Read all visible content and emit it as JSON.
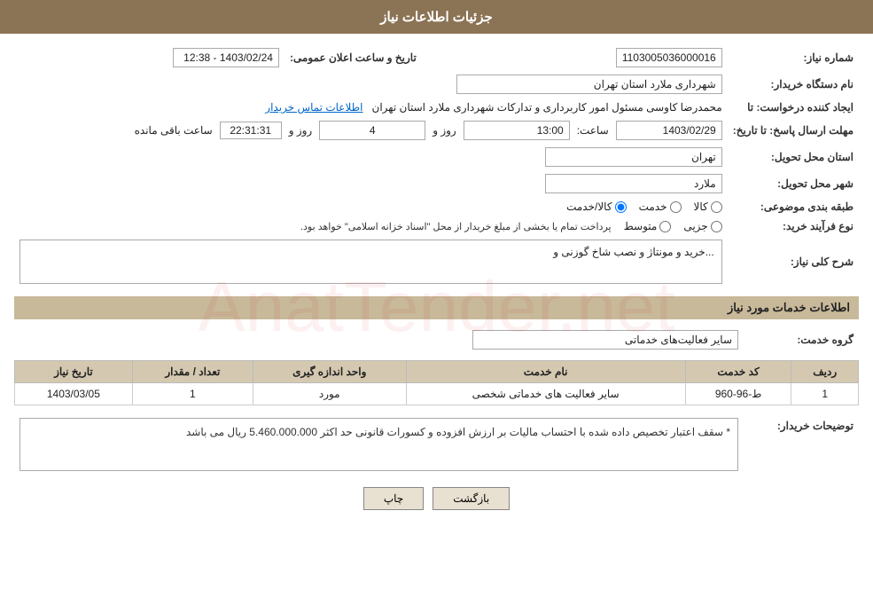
{
  "page": {
    "title": "جزئیات اطلاعات نیاز",
    "watermark": "AnatTender.net"
  },
  "header": {
    "announce_label": "تاریخ و ساعت اعلان عمومی:",
    "announce_value": "1403/02/24 - 12:38",
    "need_number_label": "شماره نیاز:",
    "need_number_value": "1103005036000016",
    "buyer_label": "نام دستگاه خریدار:",
    "buyer_value": "شهرداری ملارد استان تهران",
    "creator_label": "ایجاد کننده درخواست: تا",
    "creator_value": "محمدرضا کاوسی مسئول امور کاربرداری و تدارکات  شهرداری ملارد استان تهران",
    "contact_link": "اطلاعات تماس خریدار",
    "deadline_label": "مهلت ارسال پاسخ: تا تاریخ:",
    "deadline_date": "1403/02/29",
    "deadline_time_label": "ساعت:",
    "deadline_time": "13:00",
    "deadline_days_label": "روز و",
    "deadline_days": "4",
    "deadline_remaining_label": "ساعت باقی مانده",
    "deadline_remaining": "22:31:31",
    "province_label": "استان محل تحویل:",
    "province_value": "تهران",
    "city_label": "شهر محل تحویل:",
    "city_value": "ملارد",
    "category_label": "طبقه بندی موضوعی:",
    "category_options": [
      "کالا",
      "خدمت",
      "کالا/خدمت"
    ],
    "category_selected": "کالا/خدمت",
    "purchase_type_label": "نوع فرآیند خرید:",
    "purchase_options": [
      "جزیی",
      "متوسط"
    ],
    "purchase_note": "پرداخت تمام یا بخشی از مبلغ خریدار از محل \"اسناد خزانه اسلامی\" خواهد بود.",
    "desc_label": "شرح کلی نیاز:",
    "desc_value": "...خرید و مونتاژ و نصب شاخ گوزنی و"
  },
  "services_section": {
    "title": "اطلاعات خدمات مورد نیاز",
    "group_label": "گروه خدمت:",
    "group_value": "سایر فعالیت‌های خدماتی",
    "table_headers": [
      "ردیف",
      "کد خدمت",
      "نام خدمت",
      "واحد اندازه گیری",
      "تعداد / مقدار",
      "تاریخ نیاز"
    ],
    "table_rows": [
      {
        "row": "1",
        "code": "ط-96-960",
        "name": "سایر فعالیت های خدماتی شخصی",
        "unit": "مورد",
        "quantity": "1",
        "date": "1403/03/05"
      }
    ]
  },
  "buyer_notes": {
    "label": "توضیحات خریدار:",
    "value": "* سقف اعتبار تخصیص داده شده با احتساب مالیات بر ارزش افزوده و کسورات قانونی حد اکثر 5.460.000.000 ریال می باشد"
  },
  "buttons": {
    "print": "چاپ",
    "back": "بازگشت"
  }
}
